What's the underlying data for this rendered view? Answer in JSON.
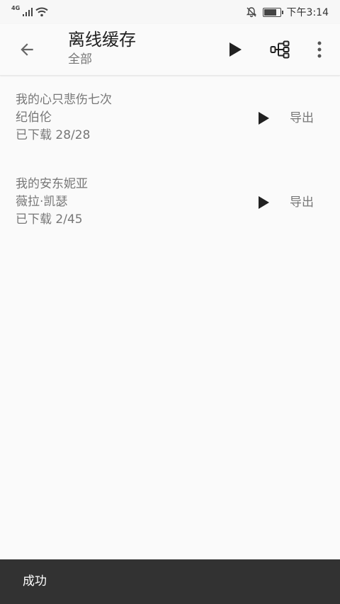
{
  "status_bar": {
    "network_label": "4G",
    "time": "下午3:14",
    "battery_level": 0.8
  },
  "app_bar": {
    "back_icon": "arrow-back-icon",
    "title": "离线缓存",
    "subtitle": "全部",
    "actions": [
      "play-icon",
      "graph-icon",
      "more-vert-icon"
    ]
  },
  "items": [
    {
      "title": "我的心只悲伤七次",
      "artist": "纪伯伦",
      "progress": "已下载 28/28",
      "export_label": "导出"
    },
    {
      "title": "我的安东妮亚",
      "artist": "薇拉·凯瑟",
      "progress": "已下载 2/45",
      "export_label": "导出"
    }
  ],
  "snackbar": {
    "message": "成功"
  }
}
